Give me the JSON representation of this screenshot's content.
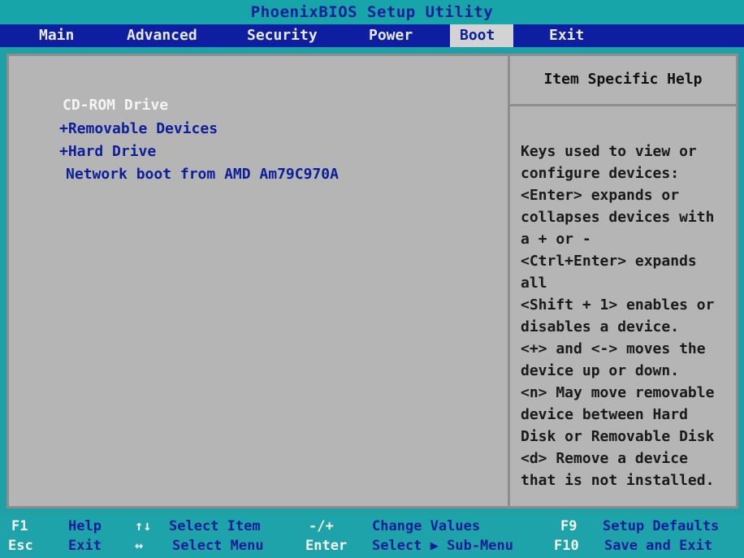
{
  "title": "PhoenixBIOS Setup Utility",
  "menu": {
    "tabs": [
      {
        "label": "Main",
        "active": false
      },
      {
        "label": "Advanced",
        "active": false
      },
      {
        "label": "Security",
        "active": false
      },
      {
        "label": "Power",
        "active": false
      },
      {
        "label": "Boot",
        "active": true
      },
      {
        "label": "Exit",
        "active": false
      }
    ]
  },
  "boot_list": {
    "items": [
      {
        "label": "CD-ROM Drive",
        "selected": true
      },
      {
        "label": "+Removable Devices",
        "selected": false
      },
      {
        "label": "+Hard Drive",
        "selected": false
      },
      {
        "label": "Network boot from AMD Am79C970A",
        "selected": false
      }
    ]
  },
  "help": {
    "title": "Item Specific Help",
    "lines": [
      "Keys used to view or",
      "configure devices:",
      "<Enter> expands or",
      "collapses devices with",
      "a + or -",
      "<Ctrl+Enter> expands",
      "all",
      "<Shift + 1> enables or",
      "disables a device.",
      "<+> and <-> moves the",
      "device up or down.",
      "<n> May move removable",
      "device between Hard",
      "Disk or Removable Disk",
      "<d> Remove a device",
      "that is not installed."
    ]
  },
  "footer": {
    "row1": [
      {
        "key": "F1",
        "desc": "Help"
      },
      {
        "key": "↑↓",
        "desc": "Select Item"
      },
      {
        "key": "-/+",
        "desc": "Change Values"
      },
      {
        "key": "F9",
        "desc": "Setup Defaults"
      }
    ],
    "row2": [
      {
        "key": "Esc",
        "desc": "Exit"
      },
      {
        "key": "↔",
        "desc": "Select Menu"
      },
      {
        "key": "Enter",
        "desc": "Select ▶ Sub-Menu"
      },
      {
        "key": "F10",
        "desc": "Save and Exit"
      }
    ]
  },
  "colors": {
    "background_cyan": "#1f9fa6",
    "menu_blue": "#0d1fa0",
    "panel_gray": "#b5b5b5",
    "text_blue": "#0c1f9a",
    "text_white": "#f4f4f4"
  }
}
